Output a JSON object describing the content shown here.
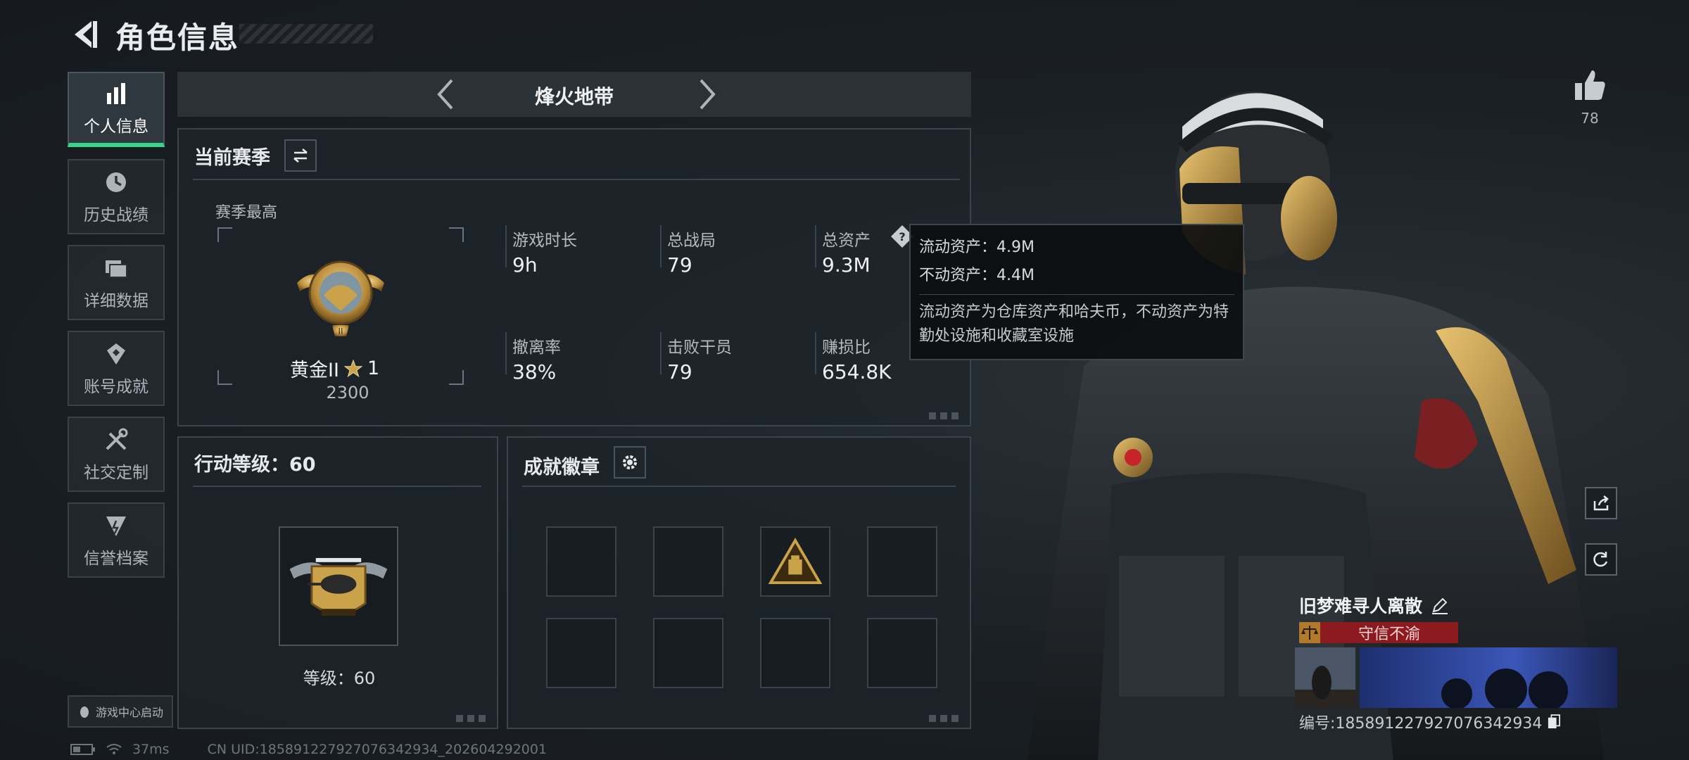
{
  "header": {
    "title": "角色信息"
  },
  "sidebar": {
    "items": [
      {
        "label": "个人信息",
        "icon": "bar-chart-icon",
        "active": true
      },
      {
        "label": "历史战绩",
        "icon": "clock-history-icon"
      },
      {
        "label": "详细数据",
        "icon": "folders-icon"
      },
      {
        "label": "账号成就",
        "icon": "achievement-icon"
      },
      {
        "label": "社交定制",
        "icon": "tools-icon"
      },
      {
        "label": "信誉档案",
        "icon": "reputation-icon"
      }
    ],
    "game_center": "游戏中心启动"
  },
  "mode_selector": {
    "name": "烽火地带"
  },
  "season": {
    "title": "当前赛季",
    "best_label": "赛季最高",
    "rank_name": "黄金II",
    "rank_stars": "1",
    "rank_points": "2300",
    "stats": [
      {
        "label": "游戏时长",
        "value": "9h"
      },
      {
        "label": "总战局",
        "value": "79"
      },
      {
        "label": "总资产",
        "value": "9.3M"
      },
      {
        "label": "撤离率",
        "value": "38%"
      },
      {
        "label": "击败干员",
        "value": "79"
      },
      {
        "label": "赚损比",
        "value": "654.8K"
      }
    ]
  },
  "tooltip": {
    "liquid": "流动资产：4.9M",
    "fixed": "不动资产：4.4M",
    "desc": "流动资产为仓库资产和哈夫币，不动资产为特勤处设施和收藏室设施"
  },
  "action_level": {
    "title": "行动等级：60",
    "level_text": "等级：60"
  },
  "badges": {
    "title": "成就徽章"
  },
  "profile": {
    "likes": "78",
    "player_name": "旧梦难寻人离散",
    "trust_title": "守信不渝",
    "player_id": "编号:1858912279270763429​34"
  },
  "status_bar": {
    "ping": "37ms",
    "uid": "CN UID:1858912279270763429​34_202604292001"
  },
  "colors": {
    "accent_green": "#35d58a",
    "trust_red": "#8d1a1e",
    "gold": "#c9a24a"
  }
}
